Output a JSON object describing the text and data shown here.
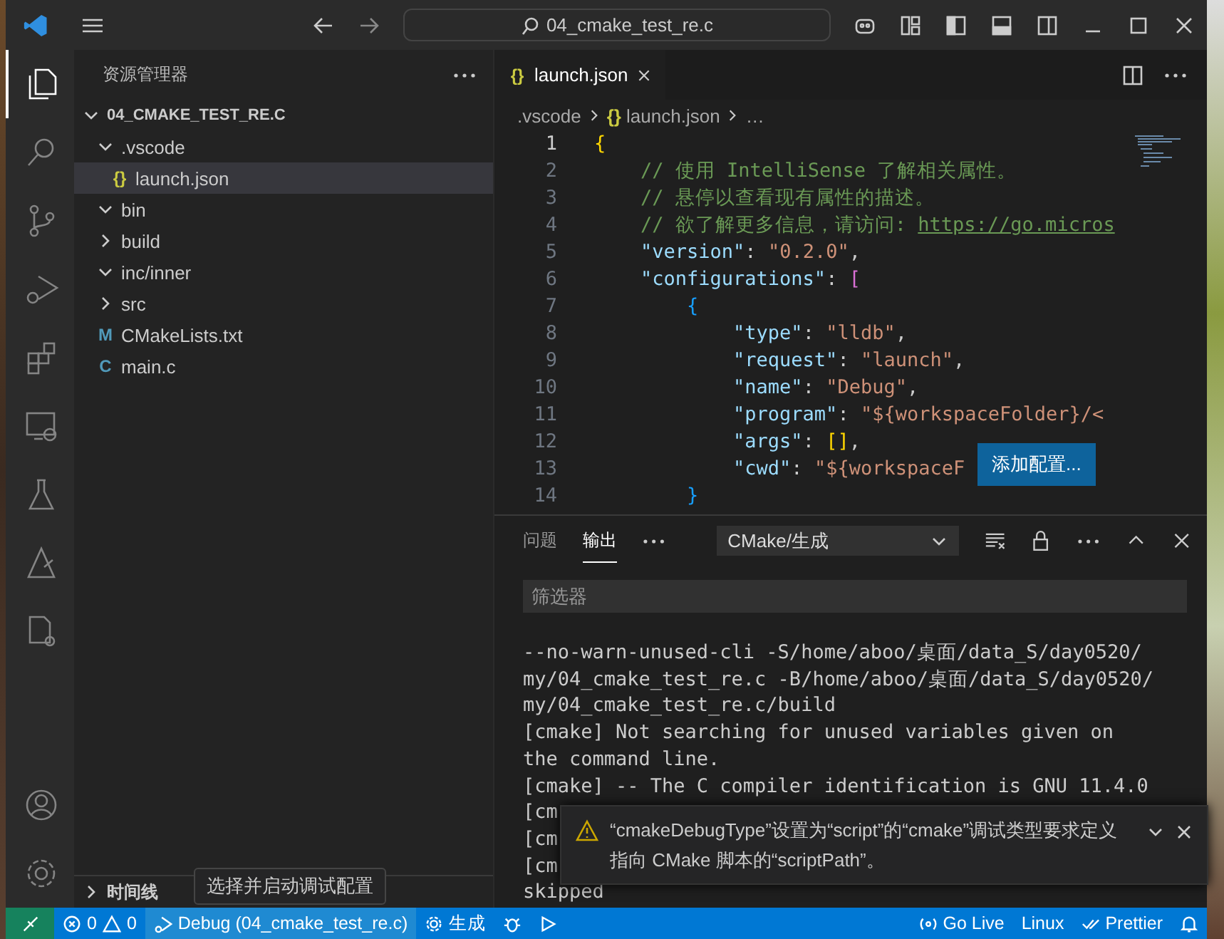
{
  "title_bar": {
    "search_text": "04_cmake_test_re.c"
  },
  "activity_bar": {
    "items": [
      {
        "kind": "explorer",
        "selected": true
      },
      {
        "kind": "search",
        "selected": false
      },
      {
        "kind": "source-control",
        "selected": false
      },
      {
        "kind": "run-debug",
        "selected": false
      },
      {
        "kind": "extensions",
        "selected": false
      },
      {
        "kind": "remote",
        "selected": false
      },
      {
        "kind": "testing",
        "selected": false
      },
      {
        "kind": "cmake",
        "selected": false
      },
      {
        "kind": "cpp-config",
        "selected": false
      }
    ],
    "bottom_items": [
      {
        "kind": "account"
      },
      {
        "kind": "settings"
      }
    ]
  },
  "sidebar": {
    "title": "资源管理器",
    "root": {
      "label": "04_CMAKE_TEST_RE.C",
      "expanded": true,
      "children": [
        {
          "kind": "folder",
          "label": ".vscode",
          "expanded": true,
          "selected": false,
          "children": [
            {
              "kind": "file",
              "label": "launch.json",
              "icon_text": "{}",
              "color": "#cbcb41",
              "selected": true
            }
          ]
        },
        {
          "kind": "folder",
          "label": "bin",
          "expanded": true,
          "selected": false
        },
        {
          "kind": "folder",
          "label": "build",
          "expanded": false,
          "selected": false
        },
        {
          "kind": "folder",
          "label": "inc/inner",
          "expanded": true,
          "selected": false
        },
        {
          "kind": "folder",
          "label": "src",
          "expanded": false,
          "selected": false
        },
        {
          "kind": "file",
          "label": "CMakeLists.txt",
          "icon_text": "M",
          "color": "#519aba",
          "selected": false
        },
        {
          "kind": "file",
          "label": "main.c",
          "icon_text": "C",
          "color": "#519aba",
          "selected": false
        }
      ]
    },
    "timeline": {
      "label": "时间线",
      "expanded": false
    }
  },
  "editor": {
    "tabs": [
      {
        "label": "launch.json",
        "icon_text": "{}",
        "selected": true
      }
    ],
    "breadcrumb": [
      {
        "label": ".vscode"
      },
      {
        "label": "launch.json",
        "icon_text": "{}"
      },
      {
        "label": "…"
      }
    ],
    "lines": [
      {
        "number": "1",
        "tokens": [
          {
            "kind": "bracket1",
            "text": "{"
          }
        ]
      },
      {
        "number": "2",
        "tokens": [
          {
            "kind": "comment",
            "text": "    // 使用 IntelliSense 了解相关属性。"
          }
        ]
      },
      {
        "number": "3",
        "tokens": [
          {
            "kind": "comment",
            "text": "    // 悬停以查看现有属性的描述。"
          }
        ]
      },
      {
        "number": "4",
        "tokens": [
          {
            "kind": "comment",
            "text": "    // 欲了解更多信息，请访问: "
          },
          {
            "kind": "link",
            "text": "https://go.micros"
          }
        ]
      },
      {
        "number": "5",
        "tokens": [
          {
            "kind": "key",
            "text": "    \"version\""
          },
          {
            "kind": "plain",
            "text": ": "
          },
          {
            "kind": "string",
            "text": "\"0.2.0\""
          },
          {
            "kind": "plain",
            "text": ","
          }
        ]
      },
      {
        "number": "6",
        "tokens": [
          {
            "kind": "key",
            "text": "    \"configurations\""
          },
          {
            "kind": "plain",
            "text": ": "
          },
          {
            "kind": "bracket2",
            "text": "["
          }
        ]
      },
      {
        "number": "7",
        "tokens": [
          {
            "kind": "bracket3",
            "text": "        {"
          }
        ]
      },
      {
        "number": "8",
        "tokens": [
          {
            "kind": "key",
            "text": "            \"type\""
          },
          {
            "kind": "plain",
            "text": ": "
          },
          {
            "kind": "string",
            "text": "\"lldb\""
          },
          {
            "kind": "plain",
            "text": ","
          }
        ]
      },
      {
        "number": "9",
        "tokens": [
          {
            "kind": "key",
            "text": "            \"request\""
          },
          {
            "kind": "plain",
            "text": ": "
          },
          {
            "kind": "string",
            "text": "\"launch\""
          },
          {
            "kind": "plain",
            "text": ","
          }
        ]
      },
      {
        "number": "10",
        "tokens": [
          {
            "kind": "key",
            "text": "            \"name\""
          },
          {
            "kind": "plain",
            "text": ": "
          },
          {
            "kind": "string",
            "text": "\"Debug\""
          },
          {
            "kind": "plain",
            "text": ","
          }
        ]
      },
      {
        "number": "11",
        "tokens": [
          {
            "kind": "key",
            "text": "            \"program\""
          },
          {
            "kind": "plain",
            "text": ": "
          },
          {
            "kind": "string",
            "text": "\"${workspaceFolder}/<"
          }
        ]
      },
      {
        "number": "12",
        "tokens": [
          {
            "kind": "key",
            "text": "            \"args\""
          },
          {
            "kind": "plain",
            "text": ": "
          },
          {
            "kind": "bracket1",
            "text": "[]"
          },
          {
            "kind": "plain",
            "text": ","
          }
        ]
      },
      {
        "number": "13",
        "tokens": [
          {
            "kind": "key",
            "text": "            \"cwd\""
          },
          {
            "kind": "plain",
            "text": ": "
          },
          {
            "kind": "string",
            "text": "\"${workspaceF"
          }
        ]
      },
      {
        "number": "14",
        "tokens": [
          {
            "kind": "bracket3",
            "text": "        }"
          }
        ]
      }
    ],
    "hover_button": "添加配置..."
  },
  "panel": {
    "tabs": [
      {
        "label": "问题",
        "selected": false
      },
      {
        "label": "输出",
        "selected": true
      }
    ],
    "channel": "CMake/生成",
    "filter_placeholder": "筛选器",
    "output_lines": [
      "--no-warn-unused-cli -S/home/aboo/桌面/data_S/day0520/",
      "my/04_cmake_test_re.c -B/home/aboo/桌面/data_S/day0520/",
      "my/04_cmake_test_re.c/build",
      "[cmake] Not searching for unused variables given on",
      "the command line.",
      "[cmake] -- The C compiler identification is GNU 11.4.0",
      "[cm",
      "[cm",
      "[cm",
      "skipped"
    ]
  },
  "notification": {
    "message": "“cmakeDebugType”设置为“script”的“cmake”调试类型要求定义指向 CMake 脚本的“scriptPath”。"
  },
  "tooltip": "选择并启动调试配置",
  "status_bar": {
    "left": [
      {
        "kind": "remote"
      },
      {
        "kind": "problems",
        "errors": "0",
        "warnings": "0"
      },
      {
        "kind": "debug-config",
        "text": "Debug (04_cmake_test_re.c)"
      },
      {
        "kind": "build",
        "text": "生成"
      },
      {
        "kind": "debug"
      },
      {
        "kind": "run"
      }
    ],
    "right": [
      {
        "kind": "golive",
        "text": "Go Live"
      },
      {
        "kind": "plain",
        "text": "Linux"
      },
      {
        "kind": "prettier",
        "text": "Prettier"
      },
      {
        "kind": "bell"
      }
    ]
  }
}
